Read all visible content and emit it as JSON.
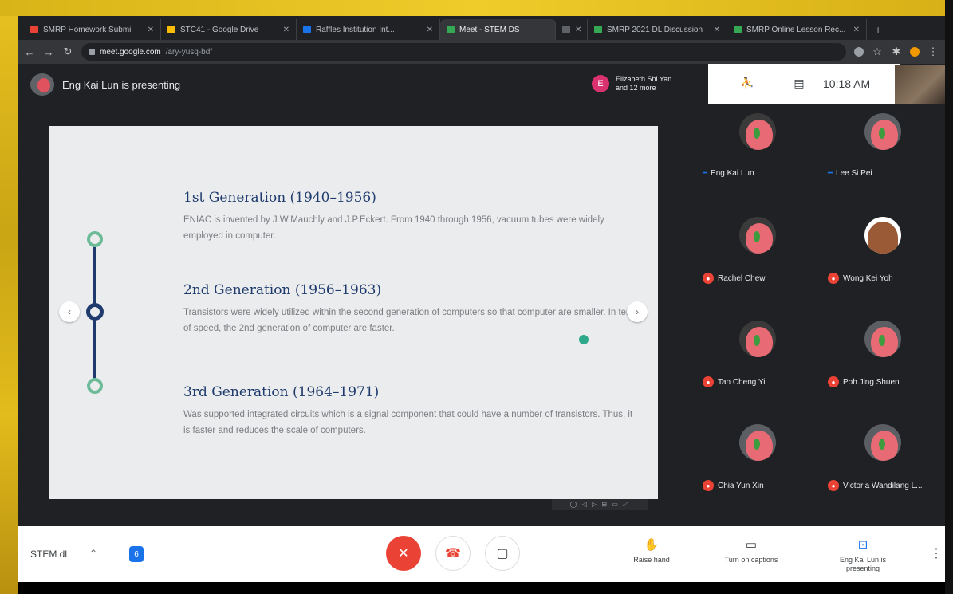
{
  "browser": {
    "tabs": [
      {
        "label": "SMRP Homework Submi",
        "color": "#ea4335"
      },
      {
        "label": "STC41 - Google Drive",
        "color": "#fbbc04"
      },
      {
        "label": "Raffles Institution Int...",
        "color": "#1a73e8"
      },
      {
        "label": "Meet - STEM DS",
        "color": "#34a853"
      },
      {
        "label": "",
        "color": "#5f6368"
      },
      {
        "label": "SMRP 2021 DL Discussion",
        "color": "#34a853"
      },
      {
        "label": "SMRP Online Lesson Rec...",
        "color": "#34a853"
      }
    ],
    "url_host": "meet.google.com",
    "url_path": "/ary-yusq-bdf"
  },
  "meet": {
    "presenting_text": "Eng Kai Lun is presenting",
    "viewers_badge": "E",
    "viewers_text": "Elizabeth Shi Yan and 12 more",
    "clock": "10:18 AM",
    "meeting_code": "STEM dl",
    "shield_label": "6"
  },
  "slide": {
    "generations": [
      {
        "title": "1st Generation (1940–1956)",
        "body": "ENIAC is invented by J.W.Mauchly and J.P.Eckert. From 1940 through 1956, vacuum tubes were widely employed in computer."
      },
      {
        "title": "2nd Generation (1956–1963)",
        "body": "Transistors were widely utilized within the second generation of computers so that computer are smaller. In term of speed, the 2nd generation of computer are faster."
      },
      {
        "title": "3rd Generation (1964–1971)",
        "body": "Was supported integrated circuits which is a signal component that could have a number of transistors. Thus, it is faster and reduces the scale of computers."
      }
    ],
    "prev_icon": "‹",
    "next_icon": "›",
    "slide_toolbar": "◯ ◁ ▷ ⊞ ▭ ⤢"
  },
  "participants": [
    {
      "name": "Eng Kai Lun",
      "muted": false,
      "avatar": "pink"
    },
    {
      "name": "Lee Si Pei",
      "muted": false,
      "avatar": "pink"
    },
    {
      "name": "Rachel Chew",
      "muted": true,
      "avatar": "pink"
    },
    {
      "name": "Wong Kei Yoh",
      "muted": true,
      "avatar": "brown"
    },
    {
      "name": "Tan Cheng Yi",
      "muted": true,
      "avatar": "pink"
    },
    {
      "name": "Poh Jing Shuen",
      "muted": true,
      "avatar": "pink"
    },
    {
      "name": "Chia Yun Xin",
      "muted": true,
      "avatar": "pink"
    },
    {
      "name": "Victoria Wandilang L...",
      "muted": true,
      "avatar": "pink"
    }
  ],
  "actions": {
    "raise_hand": "Raise hand",
    "captions": "Turn on captions",
    "presenting": "Eng Kai Lun is presenting"
  }
}
